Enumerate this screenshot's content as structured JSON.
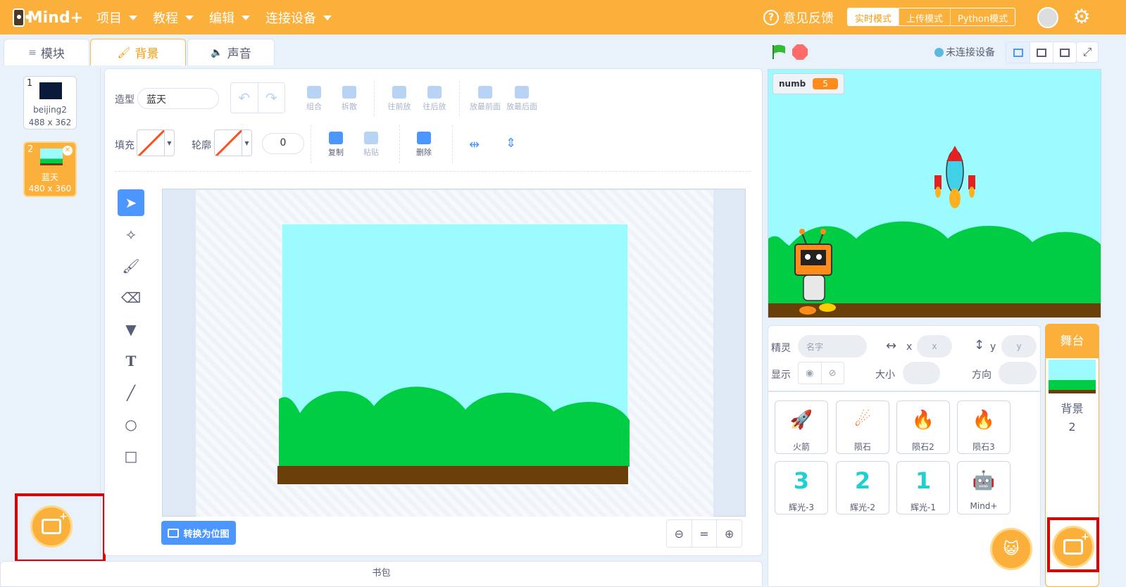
{
  "topbar": {
    "logo": "Mind+",
    "menus": [
      "项目",
      "教程",
      "编辑",
      "连接设备"
    ],
    "feedback": "意见反馈",
    "modes": [
      "实时模式",
      "上传模式",
      "Python模式"
    ]
  },
  "tabs": [
    "模块",
    "背景",
    "声音"
  ],
  "costumes": [
    {
      "num": "1",
      "name": "beijing2",
      "size": "488 x 362"
    },
    {
      "num": "2",
      "name": "蓝天",
      "size": "480 x 360"
    }
  ],
  "editor": {
    "costume_label": "造型",
    "costume_name": "蓝天",
    "tool_group": "组合",
    "tool_ungroup": "拆散",
    "tool_forward": "往前放",
    "tool_backward": "往后放",
    "tool_front": "放最前面",
    "tool_back": "放最后面",
    "fill_label": "填充",
    "outline_label": "轮廓",
    "outline_width": "0",
    "copy": "复制",
    "paste": "粘贴",
    "delete": "删除",
    "convert_bitmap": "转换为位图",
    "zoom_reset": "="
  },
  "backpack": "书包",
  "stage": {
    "connection": "未连接设备",
    "monitor_name": "numb",
    "monitor_value": "5"
  },
  "sprite_info": {
    "sprite_label": "精灵",
    "name_placeholder": "名字",
    "x_label": "x",
    "x_placeholder": "x",
    "y_label": "y",
    "y_placeholder": "y",
    "show_label": "显示",
    "size_label": "大小",
    "direction_label": "方向"
  },
  "sprites": [
    {
      "name": "火箭",
      "icon": "🚀"
    },
    {
      "name": "陨石",
      "icon": "☄"
    },
    {
      "name": "陨石2",
      "icon": "🔥"
    },
    {
      "name": "陨石3",
      "icon": "🔥"
    },
    {
      "name": "辉光-3",
      "icon": "3"
    },
    {
      "name": "辉光-2",
      "icon": "2"
    },
    {
      "name": "辉光-1",
      "icon": "1"
    },
    {
      "name": "Mind+",
      "icon": "🤖"
    }
  ],
  "stage_panel": {
    "title": "舞台",
    "backdrop_label": "背景",
    "backdrop_count": "2"
  },
  "colors": {
    "accent": "#fbb03b",
    "blue": "#4c97ff",
    "sky": "#9bfbff",
    "grass": "#00cc44",
    "ground": "#6b3f0a"
  }
}
